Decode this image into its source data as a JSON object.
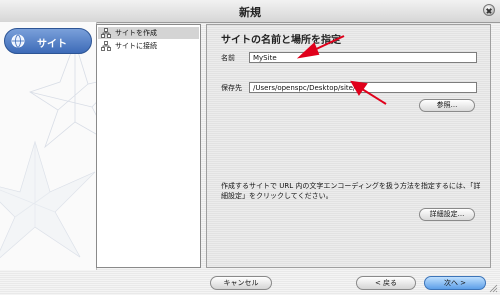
{
  "window": {
    "title": "新規"
  },
  "sidebar": {
    "tab_label": "サイト"
  },
  "list": {
    "items": [
      {
        "label": "サイトを作成",
        "selected": true
      },
      {
        "label": "サイトに接続",
        "selected": false
      }
    ]
  },
  "form": {
    "heading": "サイトの名前と場所を指定",
    "name_label": "名前",
    "name_value": "MySite",
    "location_label": "保存先",
    "location_value": "/Users/openspc/Desktop/site/",
    "browse_button": "参照...",
    "note": "作成するサイトで URL 内の文字エンコーディングを扱う方法を指定するには、「詳細設定」をクリックしてください。",
    "advanced_button": "詳細設定..."
  },
  "footer": {
    "cancel_button": "キャンセル",
    "back_button": "< 戻る",
    "next_button": "次へ >"
  },
  "colors": {
    "accent": "#3d6bb8",
    "arrow": "#e0001b"
  }
}
